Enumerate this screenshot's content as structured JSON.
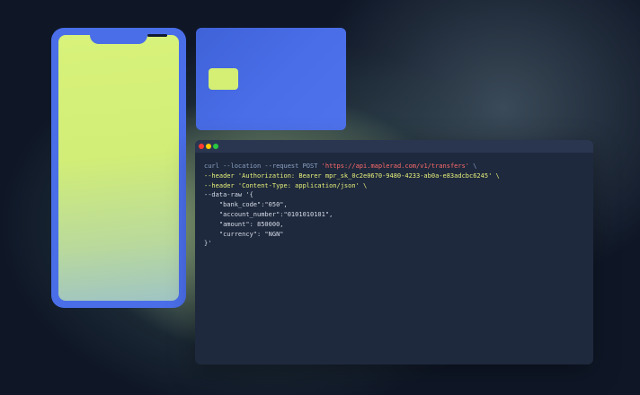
{
  "terminal": {
    "lines": [
      [
        {
          "t": "curl --location --request POST ",
          "c": "kw"
        },
        {
          "t": "'https://api.maplerad.com/v1/transfers'",
          "c": "str"
        },
        {
          "t": " \\",
          "c": "kw"
        }
      ],
      [
        {
          "t": "--header 'Authorization: Bearer mpr_sk_0c2e0670-9480-4233-ab0a-e83adcbc6245' \\",
          "c": "flag"
        }
      ],
      [
        {
          "t": "--header 'Content-Type: application/json' \\",
          "c": "flag"
        }
      ],
      [
        {
          "t": "--data-raw '{",
          "c": "plain"
        }
      ],
      [
        {
          "t": "    \"bank_code\":\"050\",",
          "c": "plain"
        }
      ],
      [
        {
          "t": "    \"account_number\":\"0101010101\",",
          "c": "plain"
        }
      ],
      [
        {
          "t": "    \"amount\": 850000,",
          "c": "plain"
        }
      ],
      [
        {
          "t": "    \"currency\": \"NGN\"",
          "c": "plain"
        }
      ],
      [
        {
          "t": "}'",
          "c": "plain"
        }
      ]
    ]
  }
}
